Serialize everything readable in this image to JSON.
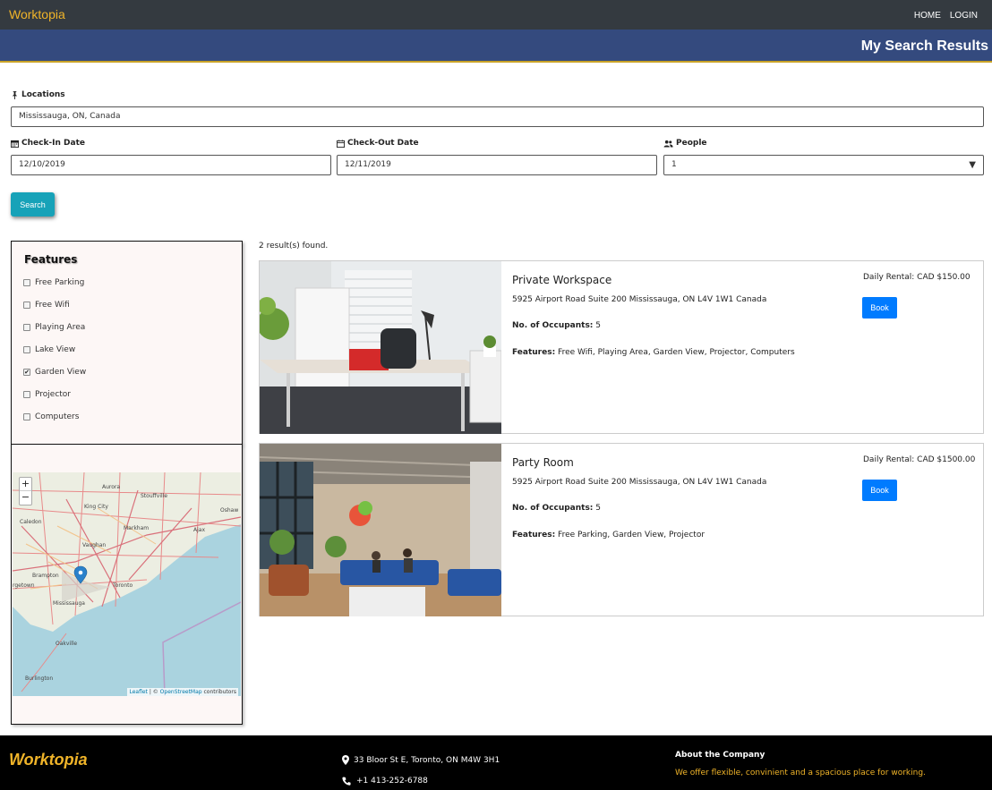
{
  "header": {
    "brand": "Worktopia",
    "nav": [
      {
        "label": "HOME"
      },
      {
        "label": "LOGIN"
      }
    ]
  },
  "banner": {
    "title": "My Search Results"
  },
  "search": {
    "location_label": "Locations",
    "location_value": "Mississauga, ON, Canada",
    "checkin_label": "Check-In Date",
    "checkin_value": "12/10/2019",
    "checkout_label": "Check-Out Date",
    "checkout_value": "12/11/2019",
    "people_label": "People",
    "people_value": "1",
    "button": "Search"
  },
  "features": {
    "title": "Features",
    "items": [
      {
        "label": "Free Parking",
        "checked": false
      },
      {
        "label": "Free Wifi",
        "checked": false
      },
      {
        "label": "Playing Area",
        "checked": false
      },
      {
        "label": "Lake View",
        "checked": false
      },
      {
        "label": "Garden View",
        "checked": true
      },
      {
        "label": "Projector",
        "checked": false
      },
      {
        "label": "Computers",
        "checked": false
      }
    ]
  },
  "map": {
    "zoom_in": "+",
    "zoom_out": "−",
    "attribution_leaflet": "Leaflet",
    "attribution_sep": " | © ",
    "attribution_osm": "OpenStreetMap",
    "attribution_rest": " contributors",
    "places": [
      "Aurora",
      "Stouffville",
      "King City",
      "Oshaw",
      "Caledon",
      "Markham",
      "Ajax",
      "Vaughan",
      "Brampton",
      "Toronto",
      "rgetown",
      "Mississauga",
      "Oakville",
      "Burlington"
    ]
  },
  "results": {
    "count_text": "2 result(s) found.",
    "occupants_label": "No. of Occupants:",
    "features_label": "Features:",
    "items": [
      {
        "title": "Private Workspace",
        "address": "5925 Airport Road Suite 200 Mississauga, ON L4V 1W1 Canada",
        "occupants": "5",
        "features": "Free Wifi, Playing Area, Garden View, Projector, Computers",
        "price": "Daily Rental: CAD $150.00",
        "button": "Book"
      },
      {
        "title": "Party Room",
        "address": "5925 Airport Road Suite 200 Mississauga, ON L4V 1W1 Canada",
        "occupants": "5",
        "features": "Free Parking, Garden View, Projector",
        "price": "Daily Rental: CAD $1500.00",
        "button": "Book"
      }
    ]
  },
  "footer": {
    "brand": "Worktopia",
    "address": "33 Bloor St E, Toronto, ON M4W 3H1",
    "phone": "+1 413-252-6788",
    "about_title": "About the Company",
    "about_text": "We offer flexible, convinient and a spacious place for working."
  },
  "colors": {
    "navbar": "#343a40",
    "banner": "#344a7e",
    "brand_accent": "#f0b429",
    "search_button": "#17a2b8",
    "book_button": "#007bff"
  }
}
